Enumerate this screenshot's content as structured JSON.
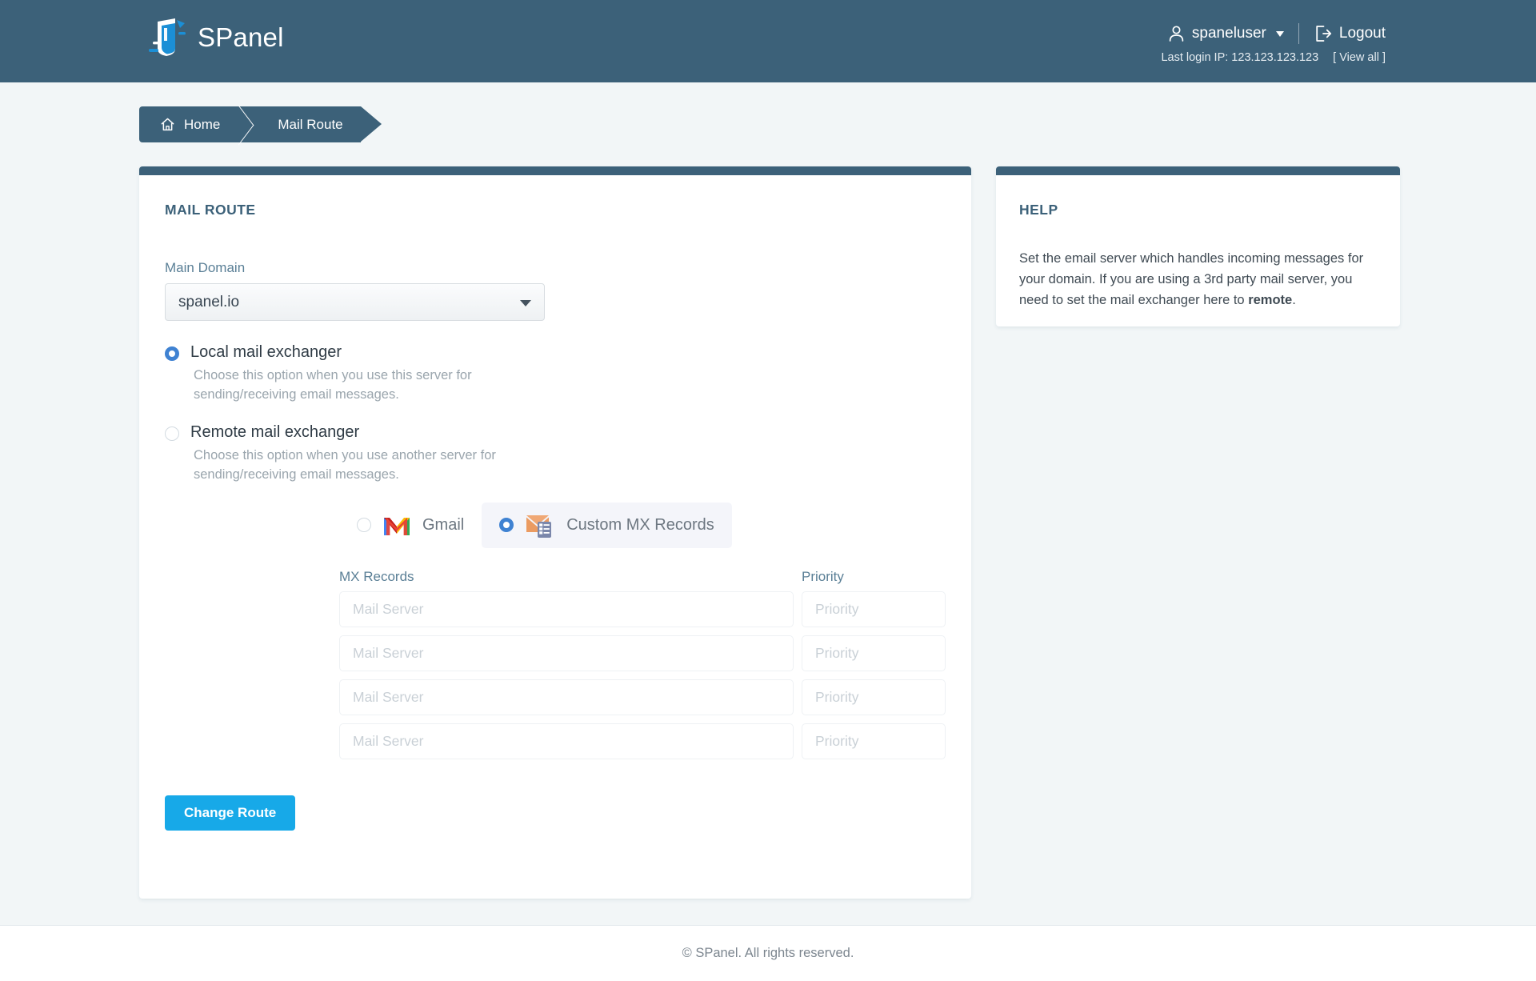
{
  "header": {
    "brand_name": "SPanel",
    "logo_icon": "spanel-logo-icon",
    "user_name": "spaneluser",
    "user_icon": "user-icon",
    "logout_label": "Logout",
    "logout_icon": "logout-icon",
    "last_login_text": "Last login IP: 123.123.123.123",
    "view_all_label": "[ View all ]"
  },
  "breadcrumb": {
    "home_label": "Home",
    "home_icon": "home-icon",
    "current_label": "Mail Route"
  },
  "main_panel": {
    "title": "MAIL ROUTE",
    "main_domain_label": "Main Domain",
    "main_domain_value": "spanel.io",
    "main_domain_options": [
      "spanel.io"
    ],
    "options": [
      {
        "title": "Local mail exchanger",
        "description": "Choose this option when you use this server for sending/receiving email messages.",
        "selected": true
      },
      {
        "title": "Remote mail exchanger",
        "description": "Choose this option when you use another server for sending/receiving email messages.",
        "selected": false
      }
    ],
    "providers": [
      {
        "label": "Gmail",
        "icon": "gmail-icon",
        "selected": false
      },
      {
        "label": "Custom MX Records",
        "icon": "custom-mx-icon",
        "selected": true
      }
    ],
    "mx_table": {
      "col_records_label": "MX Records",
      "col_priority_label": "Priority",
      "rows": [
        {
          "server_placeholder": "Mail Server",
          "server_value": "",
          "priority_placeholder": "Priority",
          "priority_value": ""
        },
        {
          "server_placeholder": "Mail Server",
          "server_value": "",
          "priority_placeholder": "Priority",
          "priority_value": ""
        },
        {
          "server_placeholder": "Mail Server",
          "server_value": "",
          "priority_placeholder": "Priority",
          "priority_value": ""
        },
        {
          "server_placeholder": "Mail Server",
          "server_value": "",
          "priority_placeholder": "Priority",
          "priority_value": ""
        }
      ]
    },
    "submit_label": "Change Route"
  },
  "help_panel": {
    "title": "HELP",
    "body_part1": "Set the email server which handles incoming messages for your domain. If you are using a 3rd party mail server, you need to set the mail exchanger here to ",
    "body_strong": "remote",
    "body_part2": "."
  },
  "footer": {
    "copyright": "© SPanel. All rights reserved."
  },
  "colors": {
    "header_bg": "#3c6179",
    "page_bg": "#f2f6f7",
    "accent_blue": "#17a9e8",
    "radio_blue": "#3f82d2",
    "label_blue": "#5a7f96"
  }
}
